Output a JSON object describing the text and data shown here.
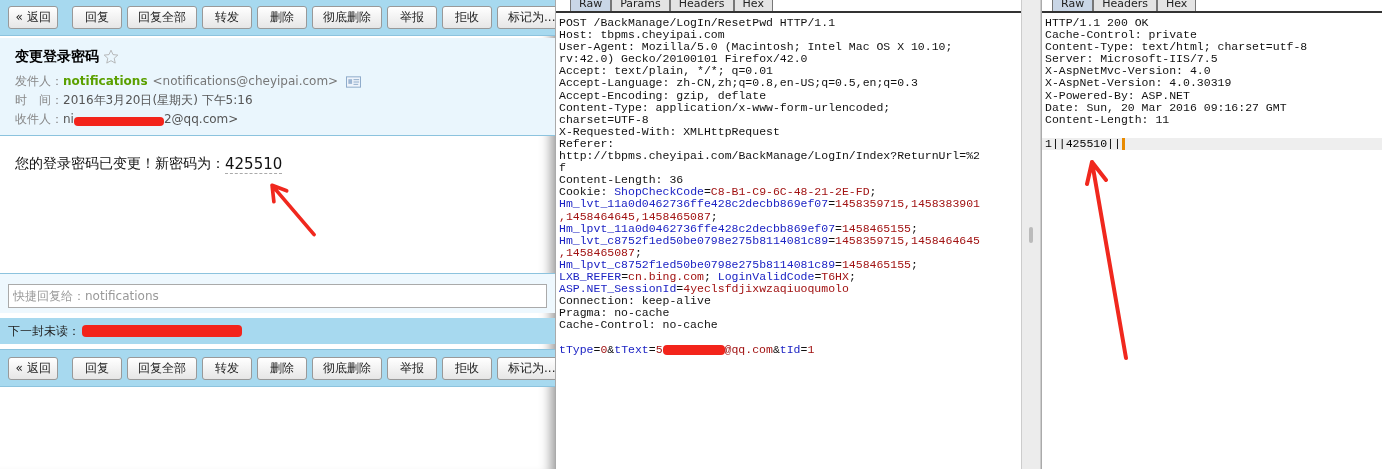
{
  "mail": {
    "toolbar_top": [
      {
        "label": "« 返回",
        "kind": "back"
      },
      {
        "label": "回复",
        "kind": "action"
      },
      {
        "label": "回复全部",
        "kind": "action"
      },
      {
        "label": "转发",
        "kind": "action"
      },
      {
        "label": "删除",
        "kind": "action"
      },
      {
        "label": "彻底删除",
        "kind": "action"
      },
      {
        "label": "举报",
        "kind": "action"
      },
      {
        "label": "拒收",
        "kind": "action"
      },
      {
        "label": "标记为...",
        "kind": "action"
      }
    ],
    "subject": "变更登录密码",
    "starred": false,
    "from_label": "发件人：",
    "from_name": "notifications",
    "from_address": "<notifications@cheyipai.com>",
    "time_label": "时　间：",
    "time": "2016年3月20日(星期天) 下午5:16",
    "to_label": "收件人：",
    "to_prefix": "ni",
    "to_suffix": "2@qq.com>",
    "body_text": "您的登录密码已变更！新密码为：",
    "body_code": "425510",
    "quick_reply": {
      "placeholder": "快捷回复给：notifications"
    },
    "next_unread_label": "下一封未读：",
    "toolbar_bottom": [
      {
        "label": "« 返回",
        "kind": "back"
      },
      {
        "label": "回复",
        "kind": "action"
      },
      {
        "label": "回复全部",
        "kind": "action"
      },
      {
        "label": "转发",
        "kind": "action"
      },
      {
        "label": "删除",
        "kind": "action"
      },
      {
        "label": "彻底删除",
        "kind": "action"
      },
      {
        "label": "举报",
        "kind": "action"
      },
      {
        "label": "拒收",
        "kind": "action"
      },
      {
        "label": "标记为...",
        "kind": "action"
      }
    ]
  },
  "request": {
    "tabs": [
      {
        "label": "Raw",
        "selected": true
      },
      {
        "label": "Params",
        "selected": false
      },
      {
        "label": "Headers",
        "selected": false
      },
      {
        "label": "Hex",
        "selected": false
      }
    ],
    "lines": [
      [
        {
          "kind": "plain",
          "text": "POST /BackManage/LogIn/ResetPwd HTTP/1.1"
        }
      ],
      [
        {
          "kind": "plain",
          "text": "Host: tbpms.cheyipai.com"
        }
      ],
      [
        {
          "kind": "plain",
          "text": "User-Agent: Mozilla/5.0 (Macintosh; Intel Mac OS X 10.10;"
        }
      ],
      [
        {
          "kind": "plain",
          "text": "rv:42.0) Gecko/20100101 Firefox/42.0"
        }
      ],
      [
        {
          "kind": "plain",
          "text": "Accept: text/plain, */*; q=0.01"
        }
      ],
      [
        {
          "kind": "plain",
          "text": "Accept-Language: zh-CN,zh;q=0.8,en-US;q=0.5,en;q=0.3"
        }
      ],
      [
        {
          "kind": "plain",
          "text": "Accept-Encoding: gzip, deflate"
        }
      ],
      [
        {
          "kind": "plain",
          "text": "Content-Type: application/x-www-form-urlencoded;"
        }
      ],
      [
        {
          "kind": "plain",
          "text": "charset=UTF-8"
        }
      ],
      [
        {
          "kind": "plain",
          "text": "X-Requested-With: XMLHttpRequest"
        }
      ],
      [
        {
          "kind": "plain",
          "text": "Referer:"
        }
      ],
      [
        {
          "kind": "plain",
          "text": "http://tbpms.cheyipai.com/BackManage/LogIn/Index?ReturnUrl=%2"
        }
      ],
      [
        {
          "kind": "plain",
          "text": "f"
        }
      ],
      [
        {
          "kind": "plain",
          "text": "Content-Length: 36"
        }
      ],
      [
        {
          "kind": "plain",
          "text": "Cookie: "
        },
        {
          "kind": "key",
          "text": "ShopCheckCode"
        },
        {
          "kind": "plain",
          "text": "="
        },
        {
          "kind": "value",
          "text": "C8-B1-C9-6C-48-21-2E-FD"
        },
        {
          "kind": "plain",
          "text": ";"
        }
      ],
      [
        {
          "kind": "key",
          "text": "Hm_lvt_11a0d0462736ffe428c2decbb869ef07"
        },
        {
          "kind": "plain",
          "text": "="
        },
        {
          "kind": "value",
          "text": "1458359715,1458383901"
        }
      ],
      [
        {
          "kind": "value",
          "text": ",1458464645,1458465087"
        },
        {
          "kind": "plain",
          "text": ";"
        }
      ],
      [
        {
          "kind": "key",
          "text": "Hm_lpvt_11a0d0462736ffe428c2decbb869ef07"
        },
        {
          "kind": "plain",
          "text": "="
        },
        {
          "kind": "value",
          "text": "1458465155"
        },
        {
          "kind": "plain",
          "text": ";"
        }
      ],
      [
        {
          "kind": "key",
          "text": "Hm_lvt_c8752f1ed50be0798e275b8114081c89"
        },
        {
          "kind": "plain",
          "text": "="
        },
        {
          "kind": "value",
          "text": "1458359715,1458464645"
        }
      ],
      [
        {
          "kind": "value",
          "text": ",1458465087"
        },
        {
          "kind": "plain",
          "text": ";"
        }
      ],
      [
        {
          "kind": "key",
          "text": "Hm_lpvt_c8752f1ed50be0798e275b8114081c89"
        },
        {
          "kind": "plain",
          "text": "="
        },
        {
          "kind": "value",
          "text": "1458465155"
        },
        {
          "kind": "plain",
          "text": ";"
        }
      ],
      [
        {
          "kind": "key",
          "text": "LXB_REFER"
        },
        {
          "kind": "plain",
          "text": "="
        },
        {
          "kind": "value",
          "text": "cn.bing.com"
        },
        {
          "kind": "plain",
          "text": "; "
        },
        {
          "kind": "key",
          "text": "LoginValidCode"
        },
        {
          "kind": "plain",
          "text": "="
        },
        {
          "kind": "value",
          "text": "T6HX"
        },
        {
          "kind": "plain",
          "text": ";"
        }
      ],
      [
        {
          "kind": "key",
          "text": "ASP.NET_SessionId"
        },
        {
          "kind": "plain",
          "text": "="
        },
        {
          "kind": "value",
          "text": "4yeclsfdjixwzaqiuoqumolo"
        }
      ],
      [
        {
          "kind": "plain",
          "text": "Connection: keep-alive"
        }
      ],
      [
        {
          "kind": "plain",
          "text": "Pragma: no-cache"
        }
      ],
      [
        {
          "kind": "plain",
          "text": "Cache-Control: no-cache"
        }
      ]
    ],
    "body": [
      {
        "kind": "key",
        "text": "tType"
      },
      {
        "kind": "plain",
        "text": "="
      },
      {
        "kind": "value",
        "text": "0"
      },
      {
        "kind": "plain",
        "text": "&"
      },
      {
        "kind": "key",
        "text": "tText"
      },
      {
        "kind": "plain",
        "text": "="
      },
      {
        "kind": "value",
        "text": "5"
      },
      {
        "kind": "redaction"
      },
      {
        "kind": "value",
        "text": "@qq.com"
      },
      {
        "kind": "plain",
        "text": "&"
      },
      {
        "kind": "key",
        "text": "tId"
      },
      {
        "kind": "plain",
        "text": "="
      },
      {
        "kind": "value",
        "text": "1"
      }
    ]
  },
  "response": {
    "tabs": [
      {
        "label": "Raw",
        "selected": true
      },
      {
        "label": "Headers",
        "selected": false
      },
      {
        "label": "Hex",
        "selected": false
      }
    ],
    "lines": [
      "HTTP/1.1 200 OK",
      "Cache-Control: private",
      "Content-Type: text/html; charset=utf-8",
      "Server: Microsoft-IIS/7.5",
      "X-AspNetMvc-Version: 4.0",
      "X-AspNet-Version: 4.0.30319",
      "X-Powered-By: ASP.NET",
      "Date: Sun, 20 Mar 2016 09:16:27 GMT",
      "Content-Length: 11"
    ],
    "body": "1||425510||"
  }
}
